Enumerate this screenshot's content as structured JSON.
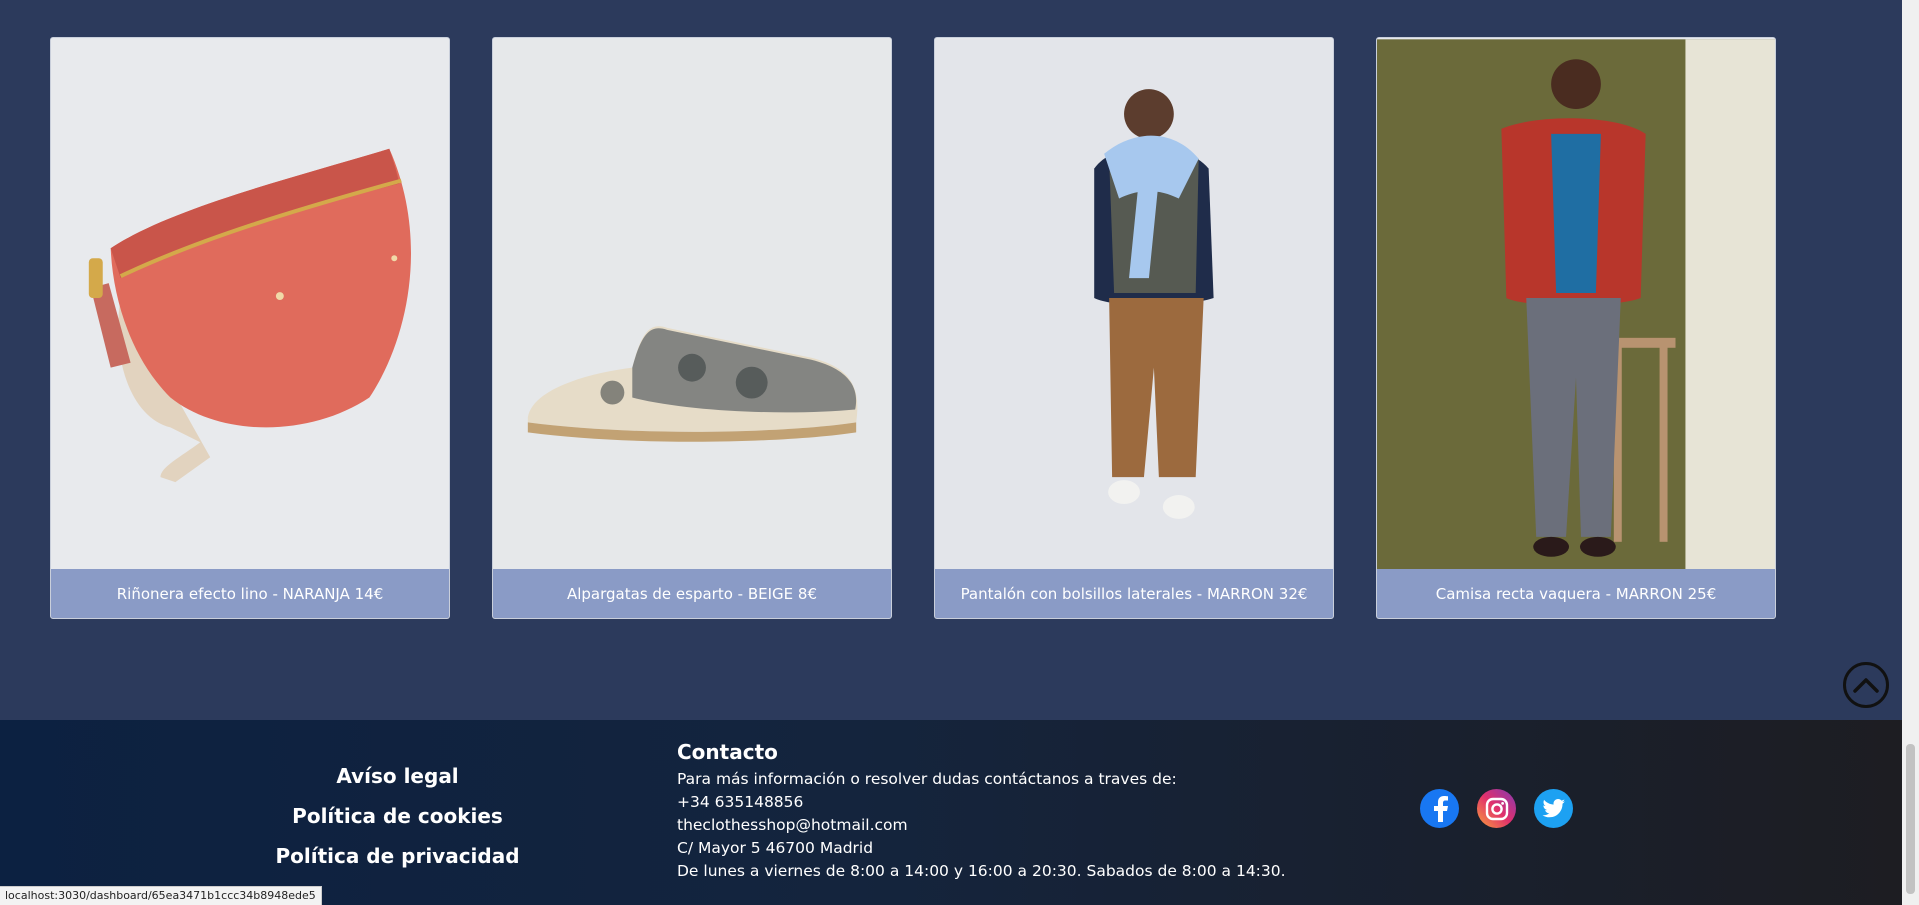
{
  "products": [
    {
      "caption": "Riñonera efecto lino - NARANJA 14€",
      "image": "orange-fanny-pack"
    },
    {
      "caption": "Alpargatas de esparto - BEIGE 8€",
      "image": "beige-espadrille"
    },
    {
      "caption": "Pantalón con bolsillos laterales - MARRON 32€",
      "image": "man-cargo-pants"
    },
    {
      "caption": "Camisa recta vaquera - MARRON 25€",
      "image": "man-red-shirt"
    }
  ],
  "footer": {
    "legal": [
      "Avíso legal",
      "Política de cookies",
      "Política de privacidad"
    ],
    "contact_title": "Contacto",
    "contact_lines": [
      "Para más información o resolver dudas contáctanos a traves de:",
      "+34 635148856",
      "theclothesshop@hotmail.com",
      "C/ Mayor 5 46700 Madrid",
      "De lunes a viernes de 8:00 a 14:00 y 16:00 a 20:30. Sabados de 8:00 a 14:30."
    ],
    "social": [
      "facebook-icon",
      "instagram-icon",
      "twitter-icon"
    ]
  },
  "status_url": "localhost:3030/dashboard/65ea3471b1ccc34b8948ede5",
  "colors": {
    "background": "#2c3a5c",
    "caption_bg": "#8a9bc6"
  }
}
